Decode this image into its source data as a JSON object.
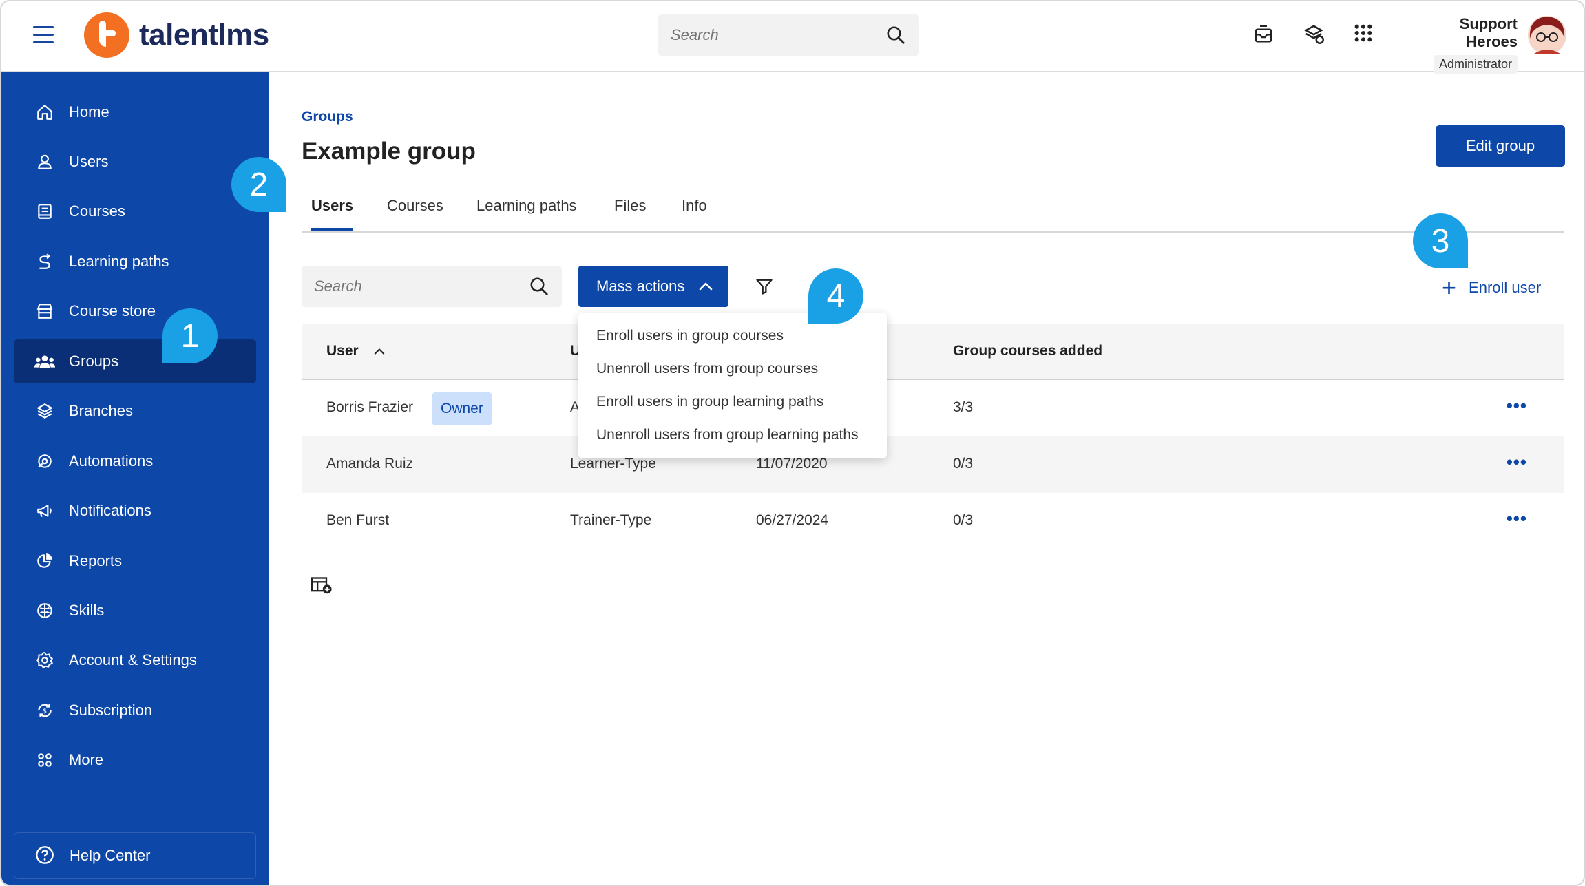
{
  "topbar": {
    "logo_text": "talentlms",
    "search_placeholder": "Search",
    "user_name": "Support Heroes",
    "user_role": "Administrator"
  },
  "sidebar": {
    "items": [
      {
        "label": "Home",
        "icon": "home-icon"
      },
      {
        "label": "Users",
        "icon": "user-icon"
      },
      {
        "label": "Courses",
        "icon": "book-icon"
      },
      {
        "label": "Learning paths",
        "icon": "path-icon"
      },
      {
        "label": "Course store",
        "icon": "store-icon"
      },
      {
        "label": "Groups",
        "icon": "groups-icon"
      },
      {
        "label": "Branches",
        "icon": "layers-icon"
      },
      {
        "label": "Automations",
        "icon": "automation-icon"
      },
      {
        "label": "Notifications",
        "icon": "megaphone-icon"
      },
      {
        "label": "Reports",
        "icon": "pie-chart-icon"
      },
      {
        "label": "Skills",
        "icon": "brain-icon"
      },
      {
        "label": "Account & Settings",
        "icon": "gear-icon"
      },
      {
        "label": "Subscription",
        "icon": "subscription-icon"
      },
      {
        "label": "More",
        "icon": "grid-icon"
      }
    ],
    "active": "Groups",
    "help_label": "Help Center"
  },
  "main": {
    "breadcrumb": "Groups",
    "title": "Example group",
    "edit_label": "Edit group",
    "tabs": [
      "Users",
      "Courses",
      "Learning paths",
      "Files",
      "Info"
    ],
    "active_tab": "Users",
    "search_placeholder": "Search",
    "mass_actions_label": "Mass actions",
    "enroll_label": "Enroll user",
    "mass_actions_menu": [
      "Enroll users in group courses",
      "Unenroll users from group courses",
      "Enroll users in group learning paths",
      "Unenroll users from group learning paths"
    ]
  },
  "table": {
    "headers": [
      "User",
      "U",
      "",
      "Group courses added"
    ],
    "rows": [
      {
        "user": "Borris Frazier",
        "badge": "Owner",
        "type": "A",
        "date": "",
        "courses": "3/3"
      },
      {
        "user": "Amanda Ruiz",
        "badge": "",
        "type": "Learner-Type",
        "date": "11/07/2020",
        "courses": "0/3"
      },
      {
        "user": "Ben Furst",
        "badge": "",
        "type": "Trainer-Type",
        "date": "06/27/2024",
        "courses": "0/3"
      }
    ]
  },
  "callouts": [
    "1",
    "2",
    "3",
    "4"
  ],
  "colors": {
    "brand_blue": "#0d47a8",
    "brand_orange": "#f36f21",
    "callout_blue": "#1aa0e5"
  }
}
